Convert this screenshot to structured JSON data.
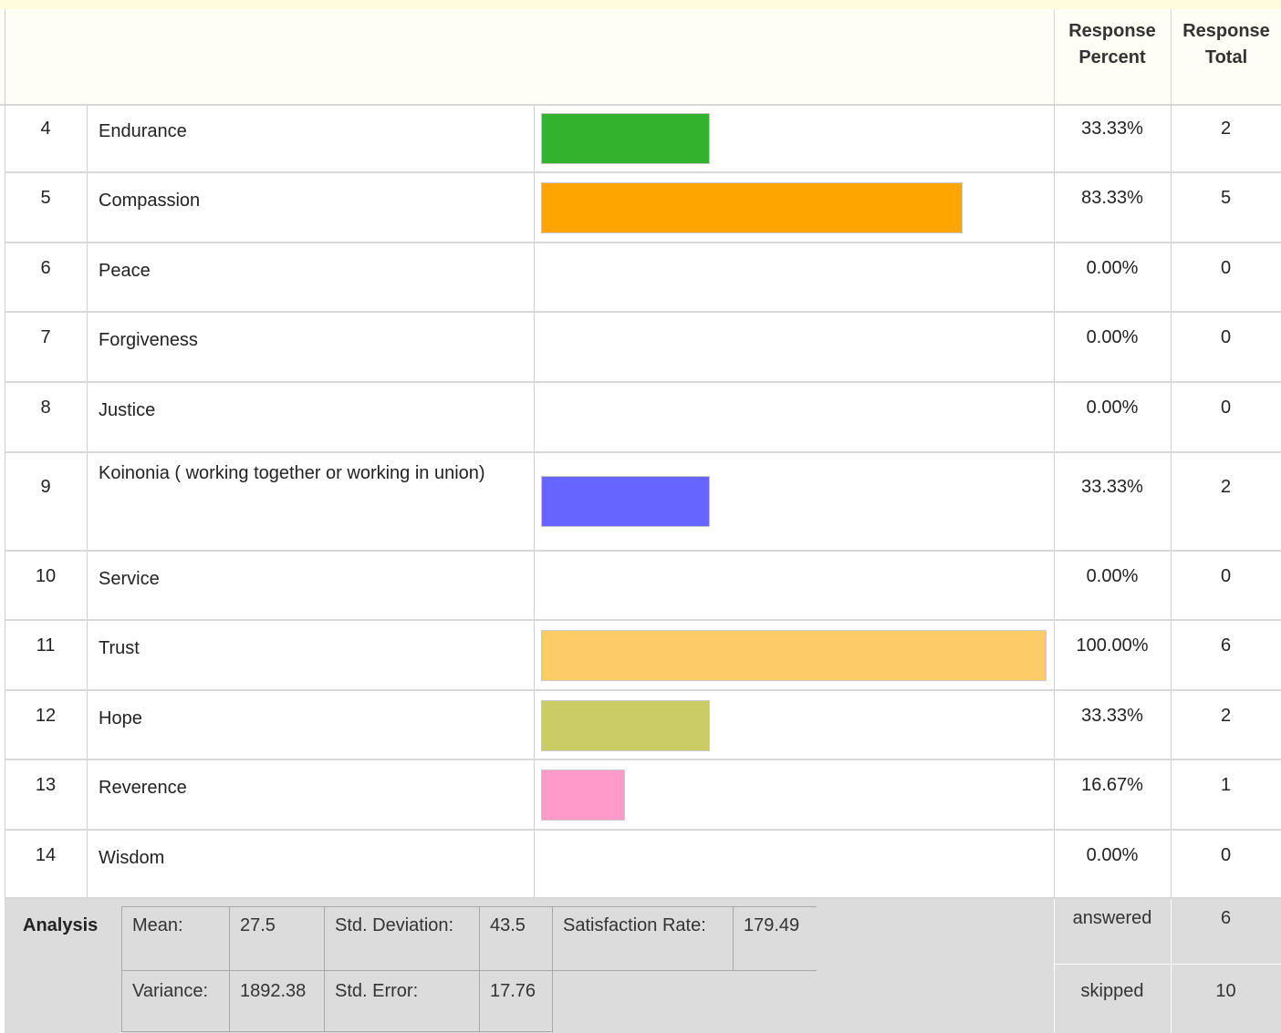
{
  "header": {
    "response_percent_line1": "Response",
    "response_percent_line2": "Percent",
    "response_total_line1": "Response",
    "response_total_line2": "Total"
  },
  "rows": [
    {
      "num": "4",
      "label": "Endurance",
      "percent": "33.33%",
      "total": "2",
      "value": 33.33,
      "color": "#33b22d"
    },
    {
      "num": "5",
      "label": "Compassion",
      "percent": "83.33%",
      "total": "5",
      "value": 83.33,
      "color": "#ffa500"
    },
    {
      "num": "6",
      "label": "Peace",
      "percent": "0.00%",
      "total": "0",
      "value": 0,
      "color": ""
    },
    {
      "num": "7",
      "label": "Forgiveness",
      "percent": "0.00%",
      "total": "0",
      "value": 0,
      "color": ""
    },
    {
      "num": "8",
      "label": "Justice",
      "percent": "0.00%",
      "total": "0",
      "value": 0,
      "color": ""
    },
    {
      "num": "9",
      "label": "Koinonia ( working together or working in union)",
      "percent": "33.33%",
      "total": "2",
      "value": 33.33,
      "color": "#6666ff"
    },
    {
      "num": "10",
      "label": "Service",
      "percent": "0.00%",
      "total": "0",
      "value": 0,
      "color": ""
    },
    {
      "num": "11",
      "label": "Trust",
      "percent": "100.00%",
      "total": "6",
      "value": 100,
      "color": "#fdcc66"
    },
    {
      "num": "12",
      "label": "Hope",
      "percent": "33.33%",
      "total": "2",
      "value": 33.33,
      "color": "#cccc66"
    },
    {
      "num": "13",
      "label": "Reverence",
      "percent": "16.67%",
      "total": "1",
      "value": 16.67,
      "color": "#ff9acb"
    },
    {
      "num": "14",
      "label": "Wisdom",
      "percent": "0.00%",
      "total": "0",
      "value": 0,
      "color": ""
    }
  ],
  "analysis": {
    "title": "Analysis",
    "mean_label": "Mean:",
    "mean_value": "27.5",
    "std_dev_label": "Std. Deviation:",
    "std_dev_value": "43.5",
    "satisfaction_label": "Satisfaction Rate:",
    "satisfaction_value": "179.49",
    "variance_label": "Variance:",
    "variance_value": "1892.38",
    "std_error_label": "Std. Error:",
    "std_error_value": "17.76"
  },
  "summary": {
    "answered_label": "answered",
    "answered_value": "6",
    "skipped_label": "skipped",
    "skipped_value": "10"
  }
}
